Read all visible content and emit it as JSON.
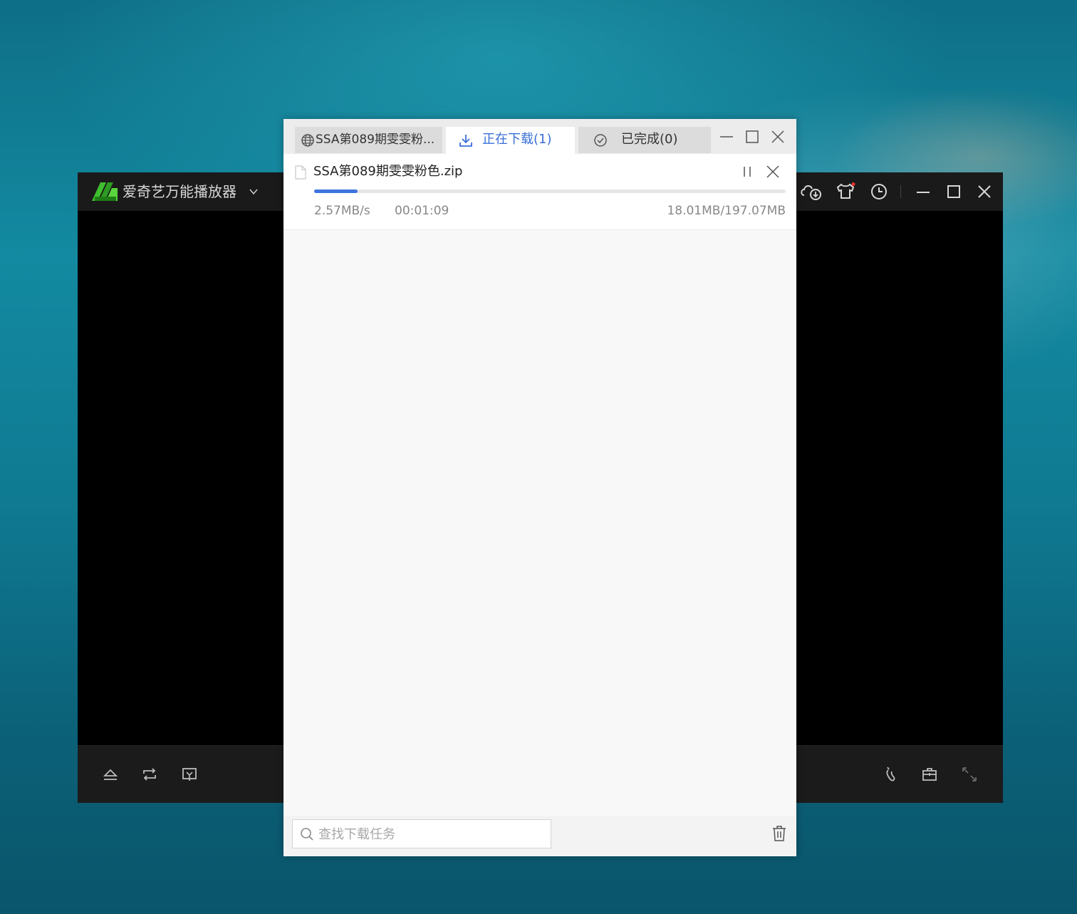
{
  "colors": {
    "accent": "#3a6fd8",
    "progress": "#3f74e0",
    "player_logo": "#3fbf2f"
  },
  "player": {
    "title": "爱奇艺万能播放器",
    "icons": [
      "dropdown-chevron",
      "cloud-download-icon",
      "skin-shirt-icon",
      "history-clock-icon",
      "minimize-icon",
      "maximize-icon",
      "close-icon",
      "eject-icon",
      "loop-icon",
      "screen-cast-icon",
      "footprint-icon",
      "toolbox-icon",
      "fullscreen-icon"
    ]
  },
  "download_manager": {
    "tabs": [
      {
        "label": "SSA第089期雯雯粉...",
        "icon": "globe-icon"
      },
      {
        "label": "正在下载(1)",
        "icon": "download-icon",
        "active": true
      },
      {
        "label": "已完成(0)",
        "icon": "check-circle-icon"
      }
    ],
    "items": [
      {
        "file_name": "SSA第089期雯雯粉色.zip",
        "speed": "2.57MB/s",
        "time_remaining": "00:01:09",
        "size": "18.01MB/197.07MB",
        "progress": 0.0914
      }
    ],
    "search": {
      "placeholder": "查找下载任务",
      "value": ""
    }
  }
}
